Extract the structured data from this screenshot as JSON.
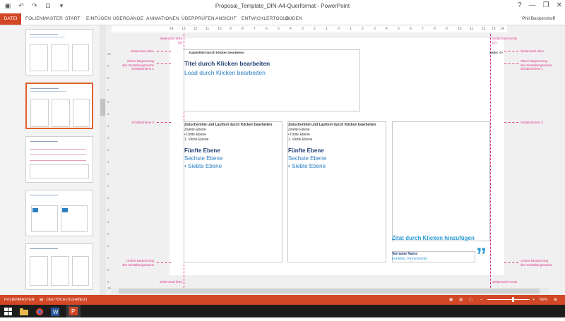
{
  "window": {
    "title": "Proposal_Template_DIN-A4-Querformat - PowerPoint",
    "user": "Phil Beckershoff",
    "controls": [
      "?",
      "—",
      "❐",
      "✕"
    ]
  },
  "quick_access": [
    "save-icon",
    "undo-icon",
    "redo-icon",
    "present-icon",
    "more-icon"
  ],
  "ribbon": {
    "tabs": [
      "DATEI",
      "FOLIENMASTER",
      "START",
      "EINFÜGEN",
      "ÜBERGÄNGE",
      "ANIMATIONEN",
      "ÜBERPRÜFEN",
      "ANSICHT",
      "ENTWICKLERTOOLS",
      "DUDEN"
    ]
  },
  "ruler": {
    "ticks": [
      "14",
      "13",
      "12",
      "11",
      "10",
      "9",
      "8",
      "7",
      "6",
      "5",
      "4",
      "3",
      "2",
      "1",
      "0",
      "1",
      "2",
      "3",
      "4",
      "5",
      "6",
      "7",
      "8",
      "9",
      "10",
      "11",
      "12",
      "13",
      "14"
    ]
  },
  "vruler": [
    "10",
    "9",
    "8",
    "7",
    "6",
    "5",
    "4",
    "3",
    "2",
    "1",
    "0",
    "1",
    "2",
    "3",
    "4",
    "5",
    "6",
    "7",
    "8",
    "9",
    "10"
  ],
  "guides": {
    "left_top": "Seitenrand links\n(X)",
    "right_top": "Seitenrand rechts\n(X)",
    "top_left": "Seitenrand oben",
    "top_right": "Seitenrand oben",
    "upper_left": "Obere Begrenzung\ndes Gestaltungsraums\nSchaltschiene 1",
    "upper_right": "Obere Begrenzung\ndes Gestaltungsraums\nSchaltschiene 1",
    "mid_left": "Schaltschiene 2",
    "mid_right": "Schaltschiene 2",
    "lower_left": "Untere Begrenzung\ndes Gestaltungsraums",
    "lower_right": "Untere Begrenzung\ndes Gestaltungsraums",
    "bottom_left": "Seitenrand links",
    "bottom_right": "Seitenrand rechts"
  },
  "slide": {
    "kapitel": "Kapiteltitel durch Klicken bearbeiten",
    "seite": "Seite: ‹#›",
    "titel": "Titel durch Klicken bearbeiten",
    "lead": "Lead durch Klicken bearbeiten",
    "col1": {
      "heading": "Zwischentitel und Lauftext durch Klicken bearbeiten",
      "l2": "Zweite Ebene",
      "l3": "•  Dritte Ebene",
      "l4": "1. Vierte Ebene",
      "l5": "Fünfte Ebene",
      "l6": "Sechste Ebene",
      "l7": "•  Siebte Ebene"
    },
    "col2": {
      "heading": "Zwischentitel und Lauftext durch Klicken bearbeiten",
      "l2": "Zweite Ebene",
      "l3": "•  Dritte Ebene",
      "l4": "1. Vierte Ebene",
      "l5": "Fünfte Ebene",
      "l6": "Sechste Ebene",
      "l7": "•  Siebte Ebene"
    },
    "zitat": "Zitat durch Klicken hinzufügen",
    "vorname": "Vorname Name",
    "funktion": "Funktion, Firmenname",
    "quote_mark": "”"
  },
  "status": {
    "mode": "FOLIENMASTER",
    "language": "DEUTSCH (SCHWEIZ)",
    "zoom": "65%"
  },
  "colors": {
    "accent": "#d24726",
    "guide": "#e0338a",
    "title_blue": "#1f3e75",
    "lead_blue": "#2b7fc3"
  }
}
